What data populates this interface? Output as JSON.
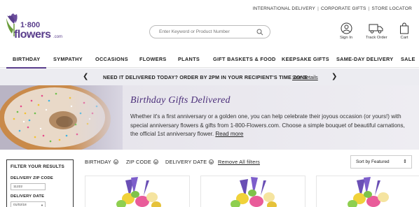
{
  "top_links": [
    "INTERNATIONAL DELIVERY",
    "CORPORATE GIFTS",
    "STORE LOCATOR"
  ],
  "logo": {
    "prefix": "1·800",
    "word": "flowers",
    "suffix": ".com"
  },
  "search": {
    "placeholder": "Enter Keyword or Product Number"
  },
  "header_icons": {
    "sign_in": "Sign In",
    "track_order": "Track Order",
    "cart": "Cart"
  },
  "nav": [
    "BIRTHDAY",
    "SYMPATHY",
    "OCCASIONS",
    "FLOWERS",
    "PLANTS",
    "GIFT BASKETS & FOOD",
    "KEEPSAKE GIFTS",
    "SAME-DAY DELIVERY",
    "SALE"
  ],
  "promo": {
    "message": "NEED IT DELIVERED TODAY? ORDER BY 2PM IN YOUR RECIPIENT'S TIME ZONE",
    "link": "See Details"
  },
  "hero": {
    "title": "Birthday Gifts Delivered",
    "text": "Whether it's a first anniversary or a golden one, you can help celebrate their joyous occasion (or yours!) with special anniversary flowers & gifts from 1-800-Flowers.com. Choose a simple bouquet of beautiful carnations, the official 1st anniversary flower.",
    "read_more": "Read more"
  },
  "sidebar": {
    "title": "FILTER YOUR RESULTS",
    "zip_label": "DELIVERY ZIP CODE",
    "zip_value": "11222",
    "date_label": "DELIVERY DATE",
    "date_value": "01/02/18"
  },
  "filters": {
    "birthday": "BIRTHDAY",
    "zip": "ZIP CODE",
    "date": "DELIVERY DATE",
    "remove_all": "Remove All filters"
  },
  "sort": {
    "selected": "Sort by Featured"
  },
  "colors": {
    "brand_purple": "#5a3e8c",
    "promo_bg": "#ececf1",
    "hero_title": "#4b2f7a"
  }
}
